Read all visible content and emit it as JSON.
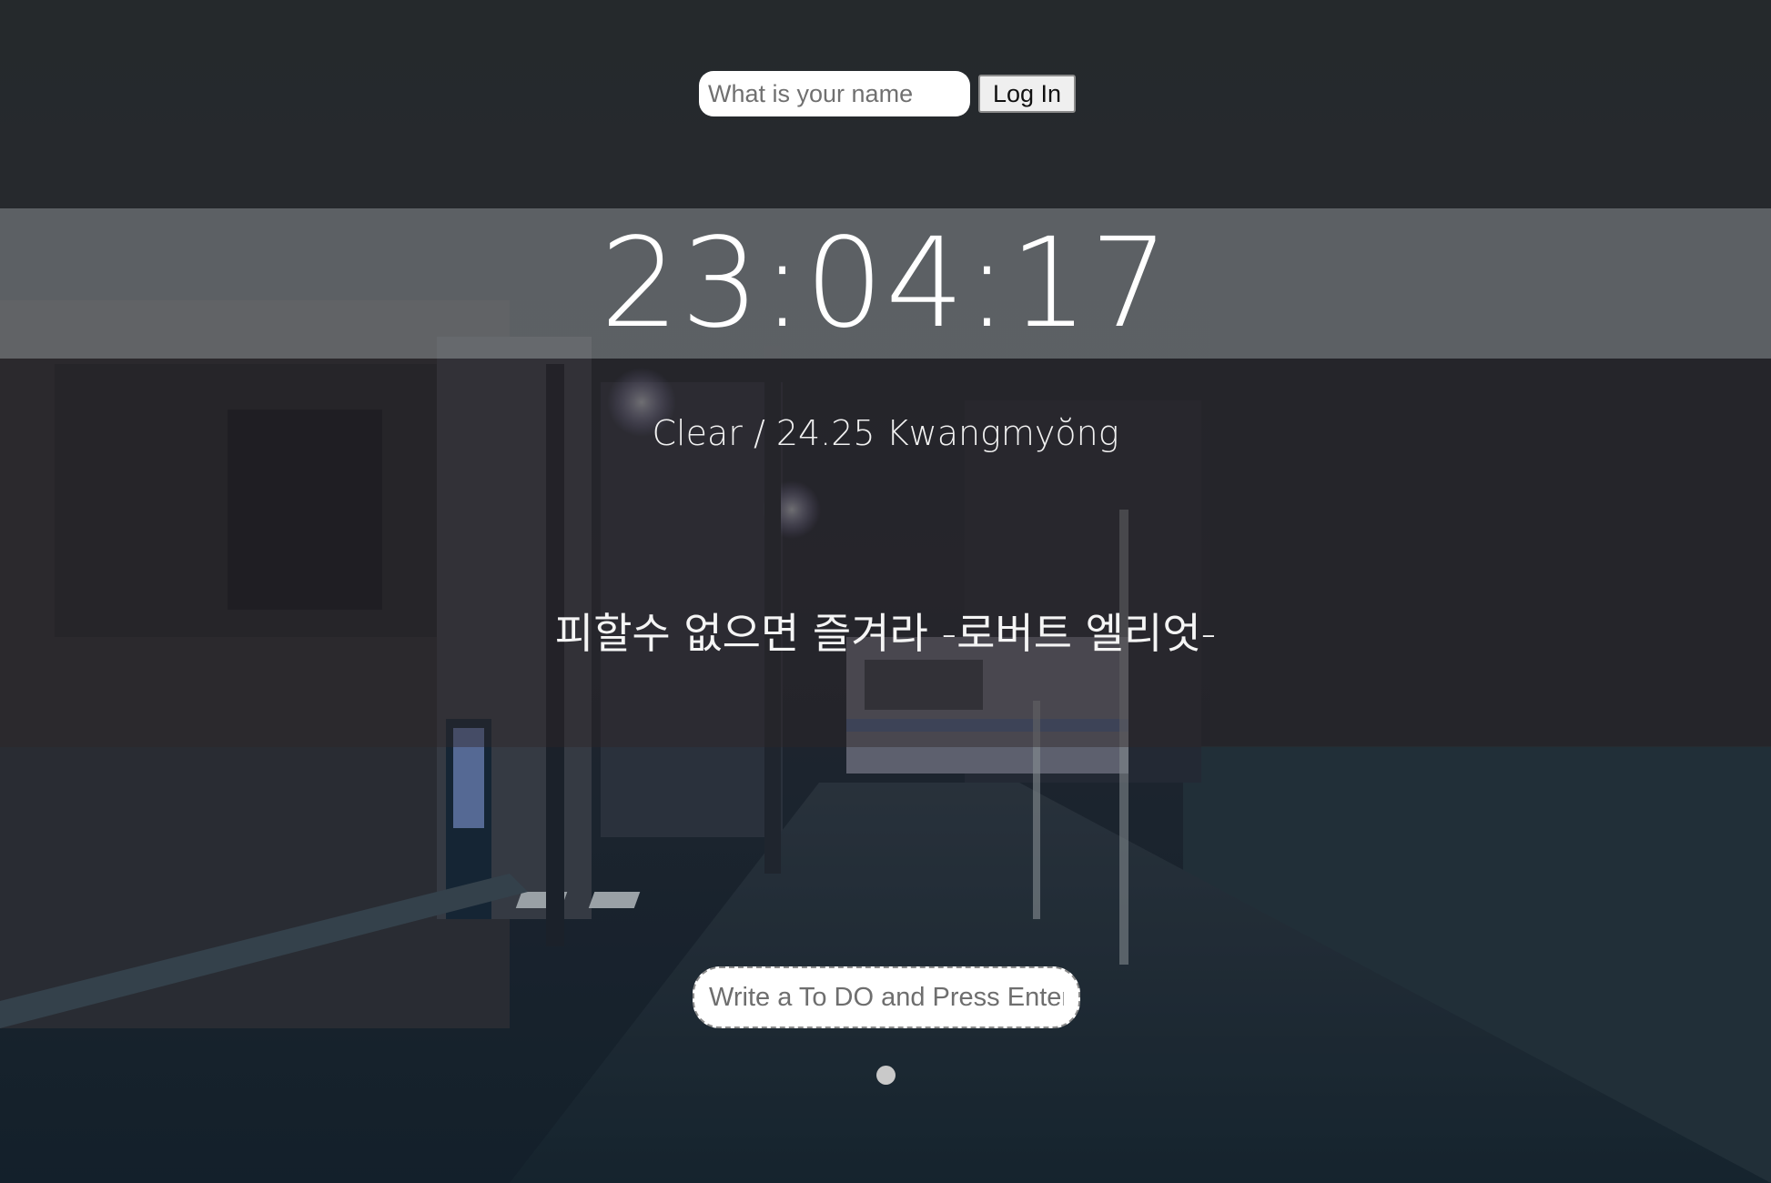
{
  "login": {
    "name_placeholder": "What is your name",
    "login_label": "Log In"
  },
  "clock": {
    "time": "23:04:17"
  },
  "weather": {
    "text": "Clear / 24.25 Kwangmyŏng"
  },
  "quote": {
    "text": "피할수 없으면 즐겨라 -로버트 엘리엇-"
  },
  "todo": {
    "placeholder": "Write a To DO and Press Enter",
    "items": []
  },
  "colors": {
    "overlay_clock": "#707678",
    "overlay_mid": "#222226",
    "text": "#ffffff"
  }
}
